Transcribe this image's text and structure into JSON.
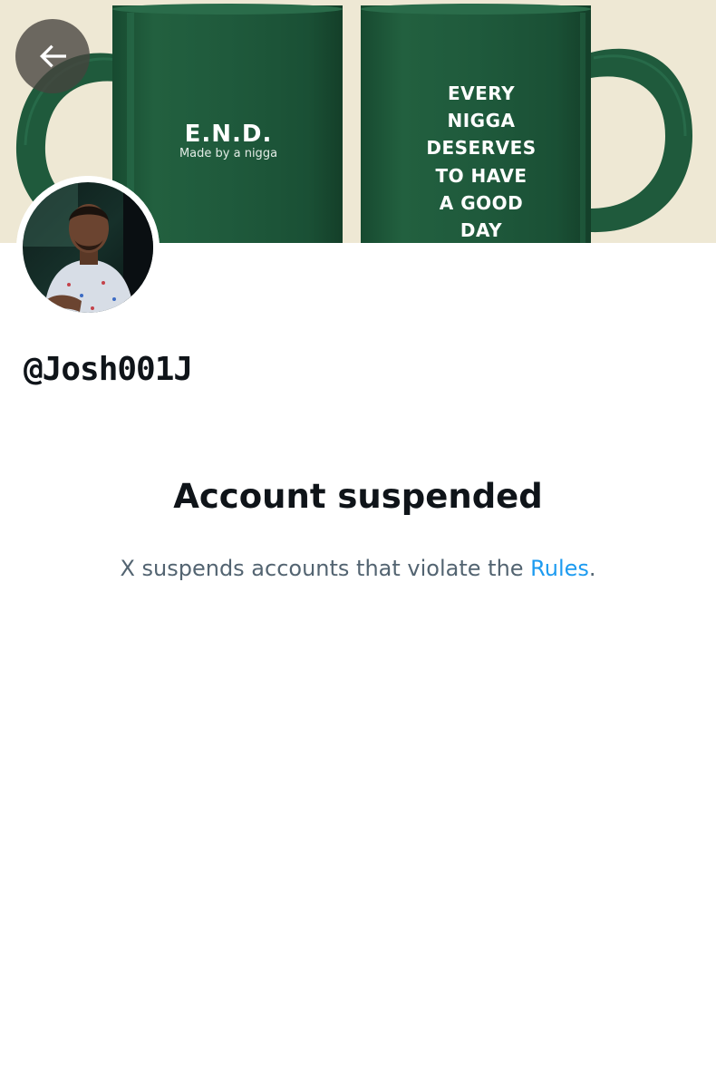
{
  "banner": {
    "brand": "E.N.D.",
    "tagline": "Made by a nigga",
    "slogan_lines": [
      "EVERY",
      "NIGGA",
      "DESERVES",
      "TO HAVE",
      "A GOOD",
      "DAY"
    ],
    "colors": {
      "background": "#eee8d4",
      "mug": "#1f5a3c"
    }
  },
  "back_button": {
    "icon": "arrow-left-icon"
  },
  "profile": {
    "handle": "@Josh001J"
  },
  "notice": {
    "title": "Account suspended",
    "body_prefix": "X suspends accounts that violate the ",
    "rules_link": "Rules",
    "body_suffix": "."
  },
  "colors": {
    "text_primary": "#0f1419",
    "text_secondary": "#536471",
    "link": "#1d9bf0"
  }
}
